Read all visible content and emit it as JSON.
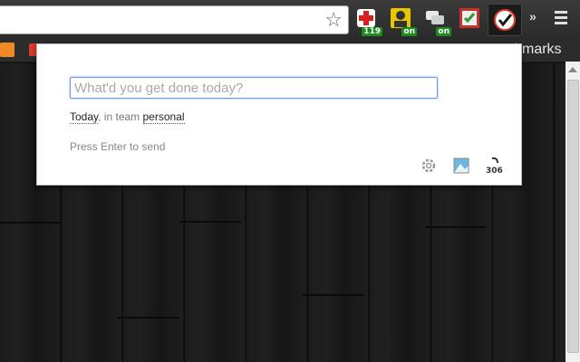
{
  "toolbar": {
    "extensions": [
      {
        "name": "first-aid-extension",
        "badge": "119"
      },
      {
        "name": "user-extension",
        "badge": "on"
      },
      {
        "name": "chat-extension",
        "badge": "on"
      },
      {
        "name": "checklist-extension",
        "badge": ""
      },
      {
        "name": "idonethis-extension",
        "badge": ""
      }
    ],
    "overflow_label": "»"
  },
  "bookmarks": {
    "visible_text": "kmarks"
  },
  "popup": {
    "input_placeholder": "What'd you get done today?",
    "input_value": "",
    "date_label": "Today",
    "team_prefix": ", in team ",
    "team_name": "personal",
    "hint": "Press Enter to send",
    "footer_icons": [
      "gear-icon",
      "image-icon",
      "numbered-badge-icon"
    ],
    "badge_number": "306"
  },
  "colors": {
    "accent": "#6b9be0",
    "badge_green": "#1e8a1e"
  }
}
